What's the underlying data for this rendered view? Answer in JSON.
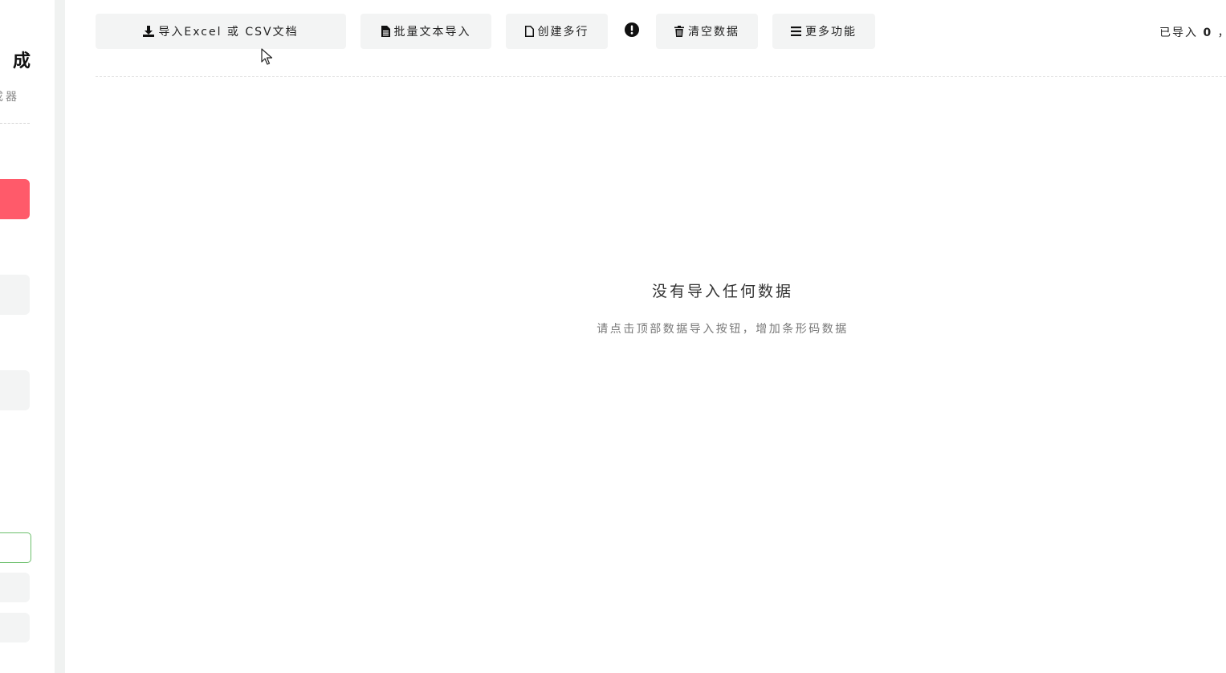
{
  "sidebar": {
    "title_fragment": "成",
    "subtitle_fragment": "成器"
  },
  "toolbar": {
    "import_excel_label": "导入Excel 或 CSV文档",
    "bulk_text_label": "批量文本导入",
    "create_rows_label": "创建多行",
    "clear_label": "清空数据",
    "more_label": "更多功能"
  },
  "counter": {
    "prefix": "已导入",
    "count": "0",
    "suffix": "，"
  },
  "empty_state": {
    "title": "没有导入任何数据",
    "hint": "请点击顶部数据导入按钮，增加条形码数据"
  },
  "colors": {
    "primary": "#ff5a6a",
    "button_bg": "#f3f4f4",
    "input_border": "#6cbf6c"
  }
}
